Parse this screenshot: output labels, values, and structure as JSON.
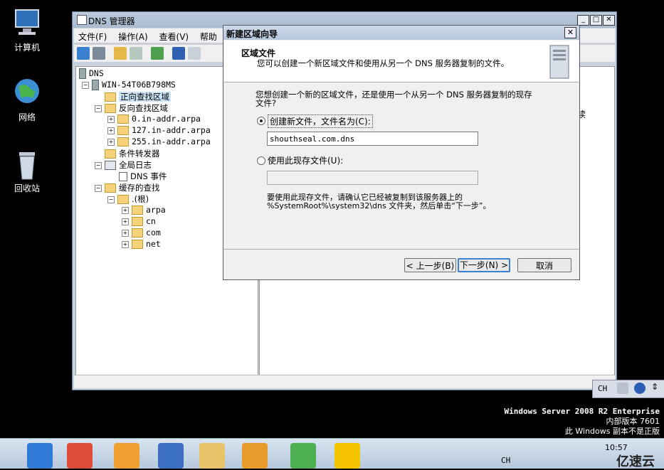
{
  "desktop": {
    "icons": [
      {
        "label": "计算机"
      },
      {
        "label": "网络"
      },
      {
        "label": "回收站"
      }
    ],
    "os_info": {
      "line1": "Windows Server 2008 R2 Enterprise",
      "line2": "内部版本 7601",
      "line3": "此 Windows 副本不是正版"
    },
    "watermark": "亿速云"
  },
  "mmc": {
    "title": "DNS 管理器",
    "menu": [
      "文件(F)",
      "操作(A)",
      "查看(V)",
      "帮助"
    ],
    "right_pane_fragment": "读",
    "tree": {
      "root": "DNS",
      "server": "WIN-54T06B798MS",
      "forward": "正向查找区域",
      "reverse": "反向查找区域",
      "rev_zones": [
        "0.in-addr.arpa",
        "127.in-addr.arpa",
        "255.in-addr.arpa"
      ],
      "conditional": "条件转发器",
      "global_logs": "全局日志",
      "dns_events": "DNS 事件",
      "cached": "缓存的查找",
      "root_hint": ".(根)",
      "cache_children": [
        "arpa",
        "cn",
        "com",
        "net"
      ]
    }
  },
  "wizard": {
    "title": "新建区域向导",
    "header_title": "区域文件",
    "header_desc": "您可以创建一个新区域文件和使用从另一个 DNS 服务器复制的文件。",
    "question_line1": "您想创建一个新的区域文件，还是使用一个从另一个 DNS 服务器复制的现存",
    "question_line2": "文件?",
    "option_new": "创建新文件，文件名为(C):",
    "new_filename": "shouthseal.com.dns",
    "option_existing": "使用此现存文件(U):",
    "existing_filename": "",
    "note_line1": "要使用此现存文件，请确认它已经被复制到该服务器上的",
    "note_line2": "%SystemRoot%\\system32\\dns 文件夹，然后单击“下一步”。",
    "btn_back": "< 上一步(B)",
    "btn_next": "下一步(N) >",
    "btn_cancel": "取消"
  },
  "systray": {
    "lang": "CH",
    "time": "10:57"
  }
}
